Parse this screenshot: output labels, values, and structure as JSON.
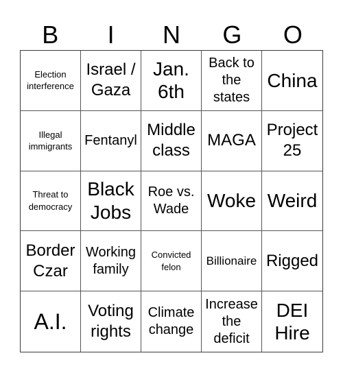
{
  "header": {
    "letters": [
      "B",
      "I",
      "N",
      "G",
      "O"
    ]
  },
  "cells": [
    {
      "text": "Election interference",
      "size": "s-xs"
    },
    {
      "text": "Israel / Gaza",
      "size": "s-lg"
    },
    {
      "text": "Jan. 6th",
      "size": "s-xl"
    },
    {
      "text": "Back to the states",
      "size": "s-md"
    },
    {
      "text": "China",
      "size": "s-xl"
    },
    {
      "text": "Illegal immigrants",
      "size": "s-xs"
    },
    {
      "text": "Fentanyl",
      "size": "s-md"
    },
    {
      "text": "Middle class",
      "size": "s-lg"
    },
    {
      "text": "MAGA",
      "size": "s-lg"
    },
    {
      "text": "Project 25",
      "size": "s-lg"
    },
    {
      "text": "Threat to democracy",
      "size": "s-xs"
    },
    {
      "text": "Black Jobs",
      "size": "s-xl"
    },
    {
      "text": "Roe vs. Wade",
      "size": "s-md"
    },
    {
      "text": "Woke",
      "size": "s-xl"
    },
    {
      "text": "Weird",
      "size": "s-xl"
    },
    {
      "text": "Border Czar",
      "size": "s-lg"
    },
    {
      "text": "Working family",
      "size": "s-md"
    },
    {
      "text": "Convicted felon",
      "size": "s-xs"
    },
    {
      "text": "Billionaire",
      "size": "s-sm"
    },
    {
      "text": "Rigged",
      "size": "s-lg"
    },
    {
      "text": "A.I.",
      "size": "s-xxl"
    },
    {
      "text": "Voting rights",
      "size": "s-lg"
    },
    {
      "text": "Climate change",
      "size": "s-md"
    },
    {
      "text": "Increase the deficit",
      "size": "s-md"
    },
    {
      "text": "DEI Hire",
      "size": "s-xl"
    }
  ]
}
